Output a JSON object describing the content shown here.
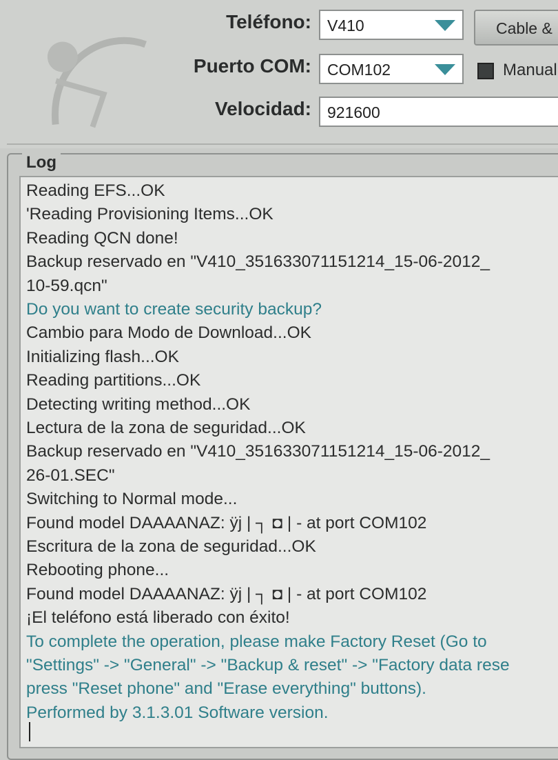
{
  "header": {
    "telefono_label": "Teléfono:",
    "telefono_value": "V410",
    "puerto_label": "Puerto COM:",
    "puerto_value": "COM102",
    "velocidad_label": "Velocidad:",
    "velocidad_value": "921600",
    "cable_button": "Cable &",
    "manual_checkbox_label": "Manual",
    "manual_checked": true
  },
  "log": {
    "title": "Log",
    "lines": [
      {
        "text": "Reading EFS...OK",
        "kind": "normal"
      },
      {
        "text": "'Reading Provisioning Items...OK",
        "kind": "normal"
      },
      {
        "text": "Reading QCN done!",
        "kind": "normal"
      },
      {
        "text": "Backup reservado en \"V410_351633071151214_15-06-2012_",
        "kind": "normal"
      },
      {
        "text": "10-59.qcn\"",
        "kind": "normal"
      },
      {
        "text": "Do you want to create security backup?",
        "kind": "info"
      },
      {
        "text": "Cambio para Modo de Download...OK",
        "kind": "normal"
      },
      {
        "text": "Initializing flash...OK",
        "kind": "normal"
      },
      {
        "text": "Reading partitions...OK",
        "kind": "normal"
      },
      {
        "text": "Detecting writing method...OK",
        "kind": "normal"
      },
      {
        "text": "Lectura de la zona de seguridad...OK",
        "kind": "normal"
      },
      {
        "text": "Backup reservado en \"V410_351633071151214_15-06-2012_",
        "kind": "normal"
      },
      {
        "text": "26-01.SEC\"",
        "kind": "normal"
      },
      {
        "text": "Switching to Normal mode...",
        "kind": "normal"
      },
      {
        "text": "Found model DAAAANAZ: ÿj | ┐ ◘ | - at port COM102",
        "kind": "normal"
      },
      {
        "text": "Escritura de la zona de seguridad...OK",
        "kind": "normal"
      },
      {
        "text": "Rebooting phone...",
        "kind": "normal"
      },
      {
        "text": "Found model DAAAANAZ: ÿj | ┐ ◘ | - at port COM102",
        "kind": "normal"
      },
      {
        "text": "¡El teléfono está liberado con éxito!",
        "kind": "normal"
      },
      {
        "text": "To complete the operation, please make Factory Reset (Go to",
        "kind": "info"
      },
      {
        "text": "\"Settings\" -> \"General\" -> \"Backup & reset\" -> \"Factory data rese",
        "kind": "info"
      },
      {
        "text": "press \"Reset phone\" and \"Erase everything\" buttons).",
        "kind": "info"
      },
      {
        "text": "Performed by 3.1.3.01 Software version.",
        "kind": "info"
      }
    ]
  }
}
